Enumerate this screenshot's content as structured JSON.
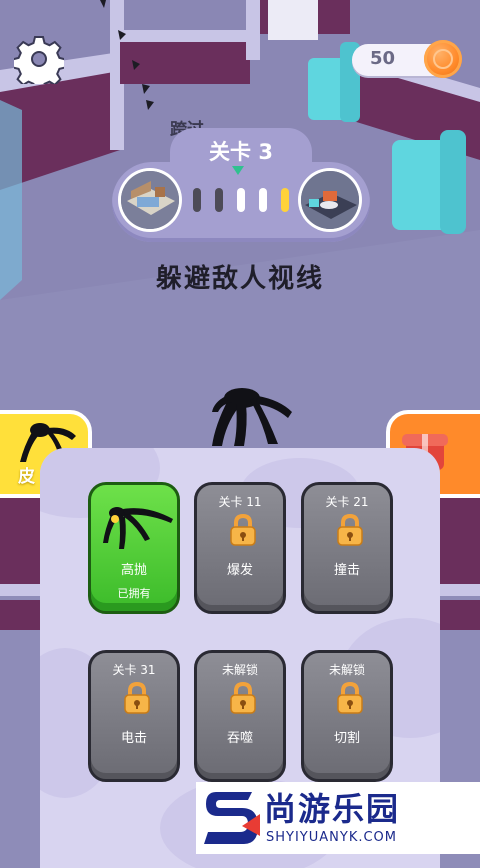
{
  "hud": {
    "settings_icon": "gear-icon",
    "coins": "50",
    "coin_icon": "coin-icon"
  },
  "skip_label": "跨过",
  "level": {
    "title": "关卡 3",
    "progress_total": 5,
    "progress_current": 5,
    "pip_colors": [
      "#4d4b57",
      "#4d4b57",
      "#ffffff",
      "#ffffff",
      "#ffd23a"
    ]
  },
  "headline": "躲避敌人视线",
  "side_buttons": {
    "skin_label": "皮",
    "gift_icon": "gift-icon"
  },
  "skins": [
    {
      "caption": "",
      "name": "高抛",
      "status": "已拥有",
      "state": "owned"
    },
    {
      "caption": "关卡 11",
      "name": "爆发",
      "status": "",
      "state": "locked"
    },
    {
      "caption": "关卡 21",
      "name": "撞击",
      "status": "",
      "state": "locked"
    },
    {
      "caption": "关卡 31",
      "name": "电击",
      "status": "",
      "state": "locked"
    },
    {
      "caption": "未解锁",
      "name": "吞噬",
      "status": "",
      "state": "locked"
    },
    {
      "caption": "未解锁",
      "name": "切割",
      "status": "",
      "state": "locked"
    }
  ],
  "watermark": {
    "logo_icon": "s-logo-icon",
    "title": "尚游乐园",
    "url": "SHYIYUANYK.COM"
  },
  "colors": {
    "floor": "#8e8cb8",
    "wall": "#6a2f5c",
    "sofa": "#5fd6df",
    "owned_card": "#4fd03a"
  }
}
